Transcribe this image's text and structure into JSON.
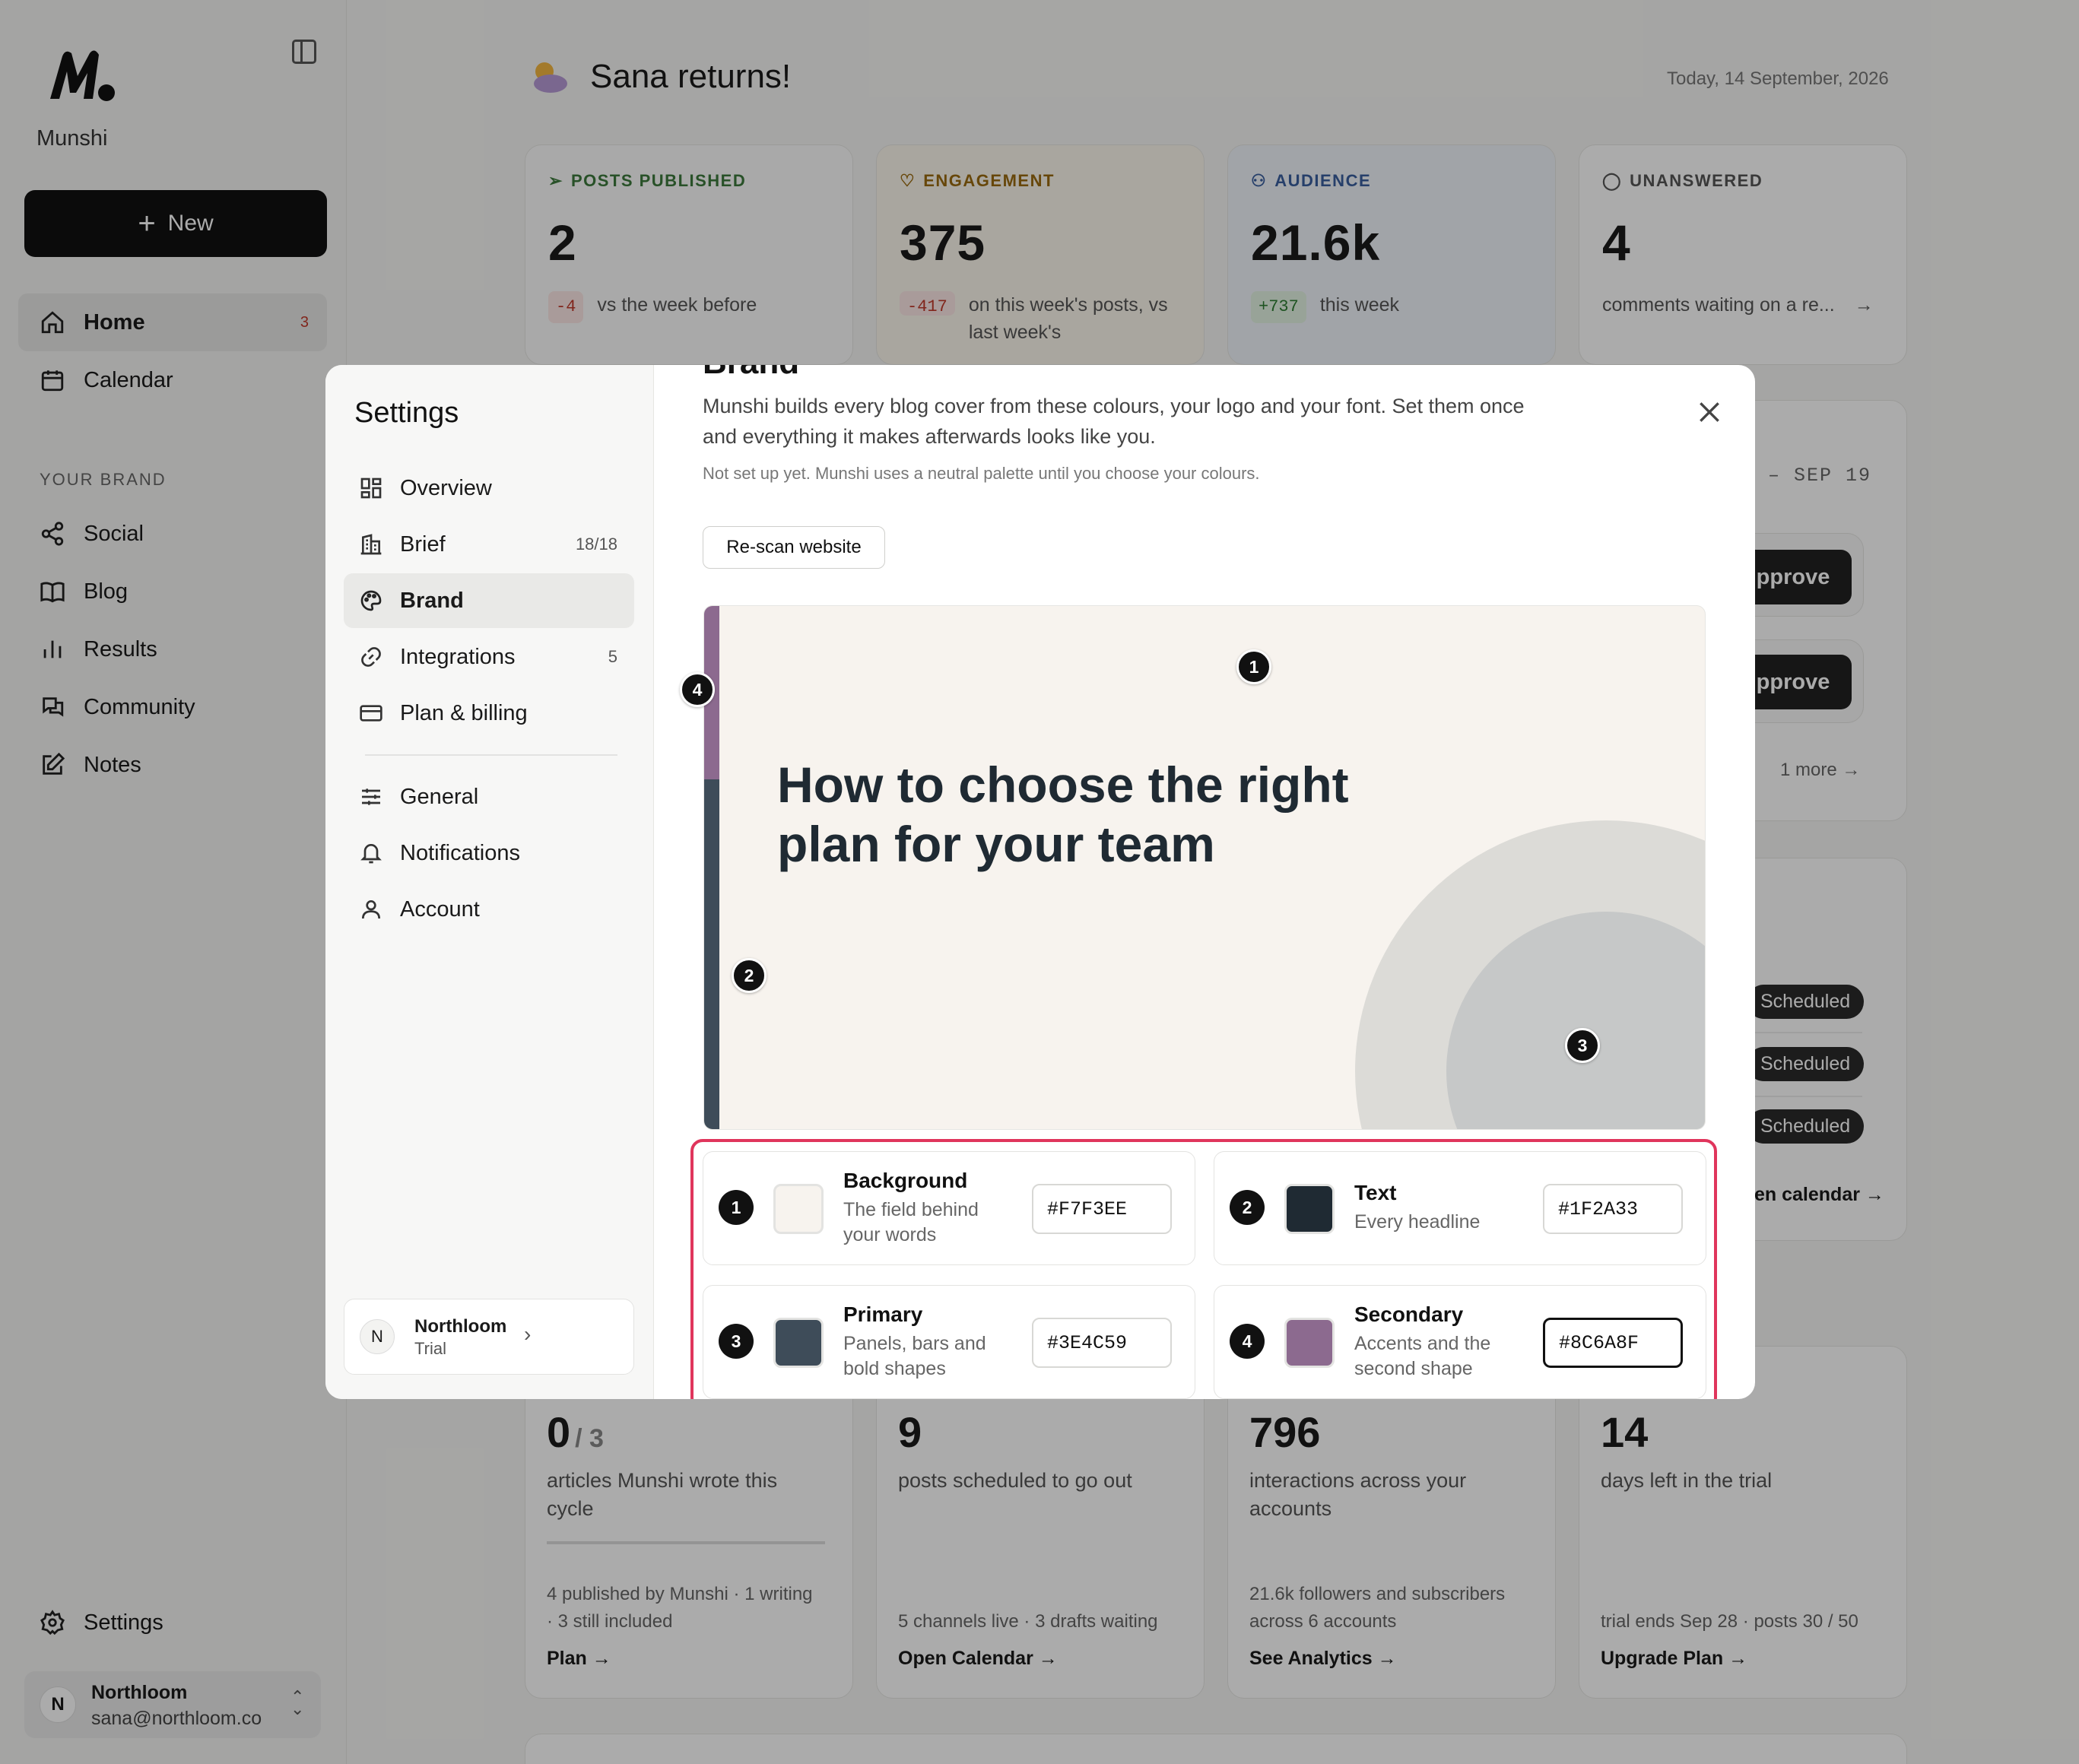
{
  "app": {
    "name": "Munshi",
    "new_label": "New"
  },
  "sidebar": {
    "items_top": [
      {
        "label": "Home",
        "count": "3"
      },
      {
        "label": "Calendar"
      }
    ],
    "section_label": "YOUR BRAND",
    "items_brand": [
      {
        "label": "Social"
      },
      {
        "label": "Blog"
      },
      {
        "label": "Results"
      },
      {
        "label": "Community"
      },
      {
        "label": "Notes"
      }
    ],
    "settings_label": "Settings",
    "account": {
      "initial": "N",
      "name": "Northloom",
      "email": "sana@northloom.co"
    }
  },
  "header": {
    "greeting": "Sana returns!",
    "date": "Today, 14 September, 2026"
  },
  "stats": [
    {
      "label": "POSTS PUBLISHED",
      "value": "2",
      "delta": "-4",
      "sub": "vs the week before",
      "color": "#3c7a3c"
    },
    {
      "label": "ENGAGEMENT",
      "value": "375",
      "delta": "-417",
      "sub": "on this week's posts, vs last week's",
      "color": "#9a6a10"
    },
    {
      "label": "AUDIENCE",
      "value": "21.6k",
      "delta": "+737",
      "sub": "this week",
      "color": "#3a5f9e"
    },
    {
      "label": "UNANSWERED",
      "value": "4",
      "sub": "comments waiting on a re..."
    }
  ],
  "background_panels": {
    "date_range": "– SEP 19",
    "approve_label": "pprove",
    "more_label": "1 more",
    "scheduled_label": "Scheduled",
    "calendar_link": "en calendar →"
  },
  "bottom_stats": [
    {
      "value": "0",
      "value_suffix": "/ 3",
      "desc": "articles Munshi wrote this cycle",
      "foot": "4 published by Munshi · 1 writing · 3 still included",
      "link": "Plan →"
    },
    {
      "value": "9",
      "desc": "posts scheduled to go out",
      "foot": "5 channels live · 3 drafts waiting",
      "link": "Open Calendar →"
    },
    {
      "value": "796",
      "desc": "interactions across your accounts",
      "foot": "21.6k followers and subscribers across 6 accounts",
      "link": "See Analytics →"
    },
    {
      "value": "14",
      "desc": "days left in the trial",
      "foot": "trial ends Sep 28 · posts 30 / 50",
      "link": "Upgrade Plan →"
    }
  ],
  "modal": {
    "title": "Settings",
    "nav": [
      {
        "label": "Overview"
      },
      {
        "label": "Brief",
        "count": "18/18"
      },
      {
        "label": "Brand"
      },
      {
        "label": "Integrations",
        "count": "5"
      },
      {
        "label": "Plan & billing"
      },
      {
        "label": "General"
      },
      {
        "label": "Notifications"
      },
      {
        "label": "Account"
      }
    ],
    "workspace": {
      "initial": "N",
      "name": "Northloom",
      "plan": "Trial"
    },
    "section_heading": "Brand",
    "description": "Munshi builds every blog cover from these colours, your logo and your font. Set them once and everything it makes afterwards looks like you.",
    "note": "Not set up yet. Munshi uses a neutral palette until you choose your colours.",
    "rescan_label": "Re-scan website",
    "preview_title": "How to choose the right plan for your team",
    "colors": [
      {
        "num": "1",
        "name": "Background",
        "desc": "The field behind your words",
        "hex": "#F7F3EE"
      },
      {
        "num": "2",
        "name": "Text",
        "desc": "Every headline",
        "hex": "#1F2A33"
      },
      {
        "num": "3",
        "name": "Primary",
        "desc": "Panels, bars and bold shapes",
        "hex": "#3E4C59"
      },
      {
        "num": "4",
        "name": "Secondary",
        "desc": "Accents and the second shape",
        "hex": "#8C6A8F"
      }
    ]
  }
}
